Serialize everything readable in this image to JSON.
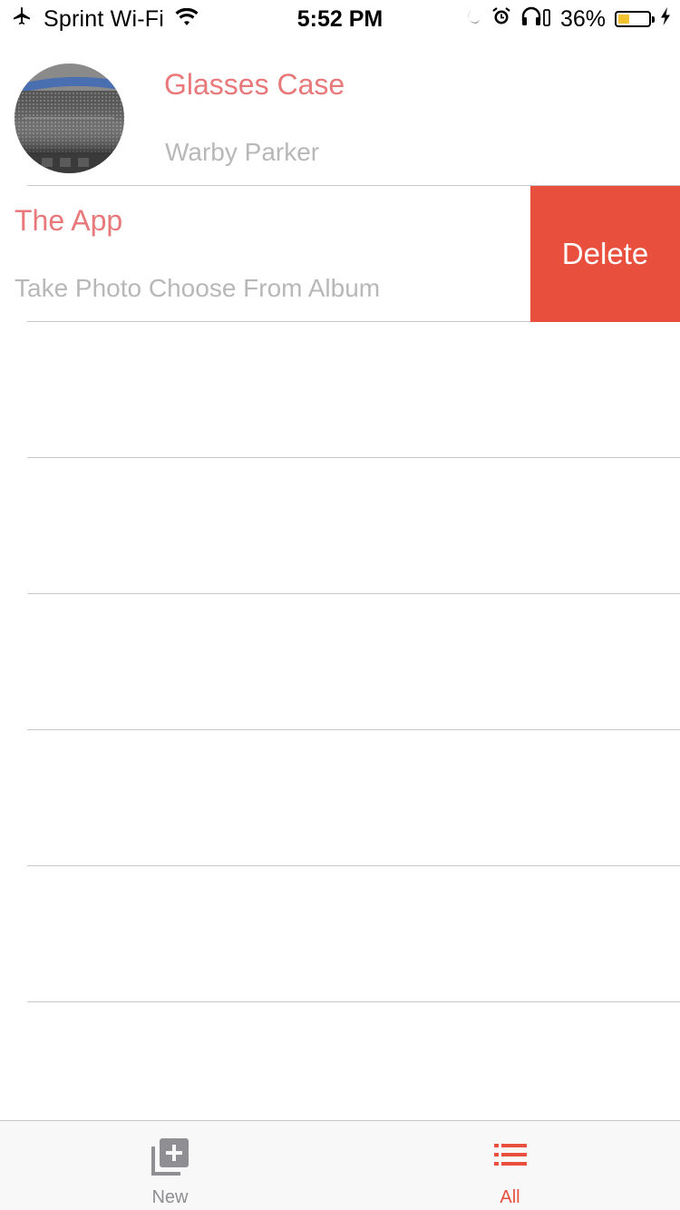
{
  "status_bar": {
    "carrier": "Sprint Wi-Fi",
    "time": "5:52 PM",
    "battery_percent": "36%",
    "battery_level": 0.36,
    "battery_color": "#f2c230",
    "icons": [
      "airplane-icon",
      "wifi-icon",
      "moon-icon",
      "alarm-icon",
      "headphones-icon",
      "battery-icon",
      "charging-bolt-icon"
    ]
  },
  "list": {
    "items": [
      {
        "title": "Glasses Case",
        "subtitle": "Warby Parker",
        "has_thumbnail": true
      },
      {
        "title": "The App",
        "subtitle": "Take Photo Choose From Album",
        "has_thumbnail": false,
        "swipe_action": "Delete"
      }
    ],
    "empty_rows": 6
  },
  "tab_bar": {
    "tabs": [
      {
        "label": "New",
        "icon": "add-photo-icon",
        "selected": false
      },
      {
        "label": "All",
        "icon": "list-icon",
        "selected": true
      }
    ]
  },
  "colors": {
    "accent": "#e8787a",
    "delete": "#e84f3d",
    "subtitle": "#b8b8b8",
    "separator": "#c8c7cc"
  }
}
